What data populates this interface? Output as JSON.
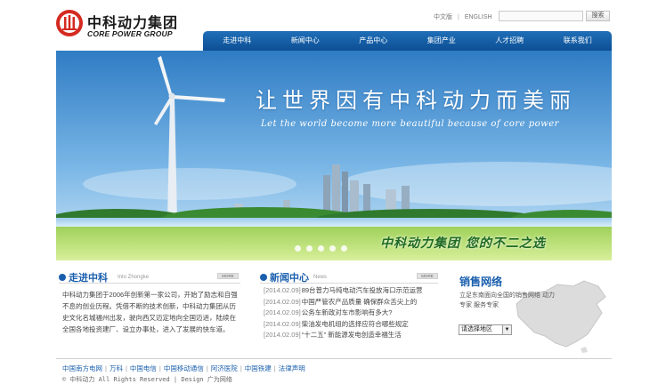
{
  "header": {
    "logo_cn": "中科动力集团",
    "logo_en": "CORE POWER GROUP",
    "lang_cn": "中文版",
    "lang_sep": "|",
    "lang_en": "ENGLISH",
    "search_placeholder": "",
    "search_button": "搜索"
  },
  "nav": {
    "items": [
      "走进中科",
      "新闻中心",
      "产品中心",
      "集团产业",
      "人才招聘",
      "联系我们"
    ]
  },
  "banner": {
    "title": "让世界因有中科动力而美丽",
    "subtitle": "Let the world become more beautiful because of core power",
    "slogan": "中科动力集团 您的不二之选"
  },
  "about": {
    "title": "走进中科",
    "subtitle": "Into Zhongke",
    "more": "MORE",
    "text": "中科动力集团于2006年创新第一家公司，开始了励志和自强不息的创业历程。凭借不断的技术创新，中科动力集团从历史文化名城福州出发，驶向西又迈定地向全国迈进，陆续在全国各地投资建厂、设立办事处，进入了发展的快车道。"
  },
  "news": {
    "title": "新闻中心",
    "subtitle": "News",
    "more": "MORE",
    "items": [
      {
        "date": "[2014.02.09]",
        "text": "89台普力马纯电动汽车投放海口示范运营"
      },
      {
        "date": "[2014.02.09]",
        "text": "中国严管农产品质量 确保群众舌尖上的"
      },
      {
        "date": "[2014.02.09]",
        "text": "公务车新政对车市影响有多大?"
      },
      {
        "date": "[2014.02.09]",
        "text": "柴油发电机组的选择应符合哪些规定"
      },
      {
        "date": "[2014.02.09]",
        "text": "“十二五” 新能源发电创造幸福生活"
      }
    ]
  },
  "sales": {
    "title": "销售网络",
    "text": "立足东南面向全国的销售网络 动力专家 服务专家",
    "select_label": "请选择地区"
  },
  "footer": {
    "links": [
      "中国南方电网",
      "万科",
      "中国电信",
      "中国移动通信",
      "阿济医院",
      "中国铁建",
      "法律声明"
    ],
    "copyright": "© 中科动力 All Rights Reserved | Design 广为网络"
  },
  "colors": {
    "brand_blue": "#1a5fae",
    "nav_blue": "#0d4f95",
    "logo_red": "#d42a20",
    "slogan_green": "#1f6a22"
  }
}
